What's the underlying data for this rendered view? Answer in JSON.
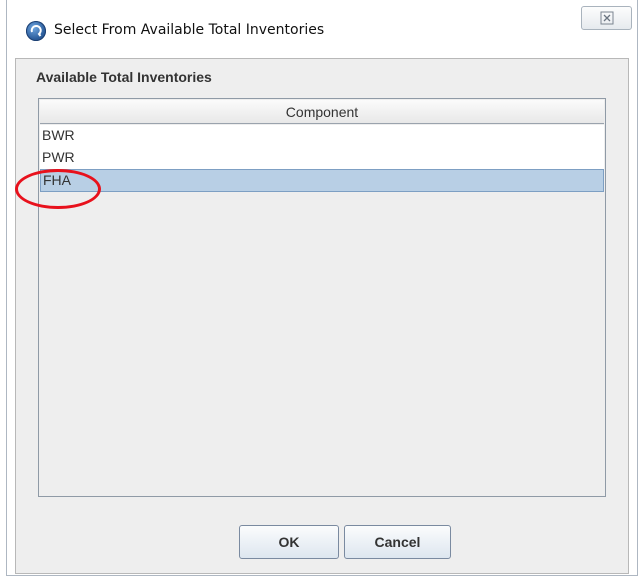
{
  "window": {
    "title": "Select From Available Total Inventories",
    "close_label": "⊠"
  },
  "panel": {
    "label": "Available Total Inventories"
  },
  "table": {
    "columns": [
      "Component"
    ],
    "rows": [
      {
        "component": "BWR",
        "selected": false
      },
      {
        "component": "PWR",
        "selected": false
      },
      {
        "component": "FHA",
        "selected": true
      }
    ]
  },
  "buttons": {
    "ok_label": "OK",
    "cancel_label": "Cancel"
  },
  "colors": {
    "selection": "#b8cfe5",
    "annotation_circle": "#e8111c"
  }
}
